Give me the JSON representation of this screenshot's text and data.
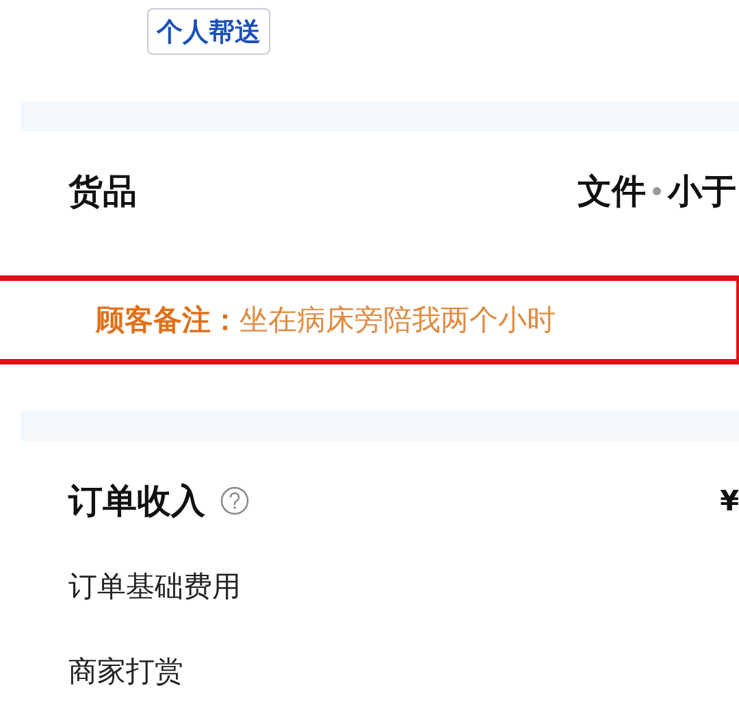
{
  "delivery_badge": "个人帮送",
  "goods": {
    "label": "货品",
    "value_parts": [
      "文件",
      "小于"
    ]
  },
  "customer_note": {
    "text": "**顾客备注：**坐在病床旁陪我两个小时",
    "highlighted": true
  },
  "income": {
    "title": "订单收入",
    "currency": "¥",
    "items": [
      "订单基础费用",
      "商家打赏"
    ]
  }
}
